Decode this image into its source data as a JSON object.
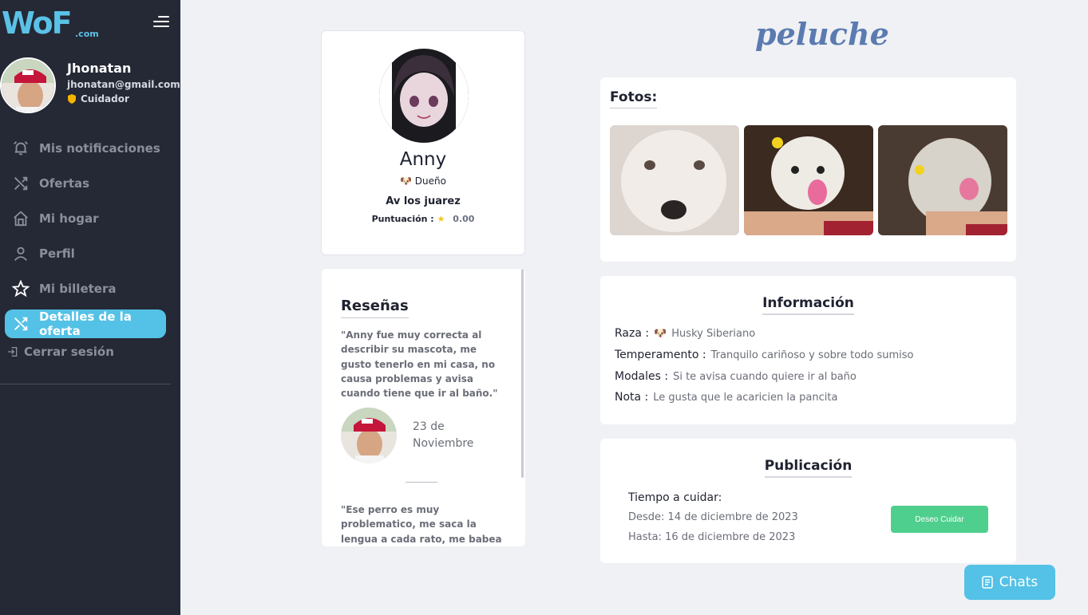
{
  "brand": {
    "logo_text": "WoF",
    "logo_domain": ".com"
  },
  "user": {
    "name": "Jhonatan",
    "email": "jhonatan@gmail.com",
    "role": "Cuidador"
  },
  "nav": {
    "items": [
      {
        "label": "Mis notificaciones",
        "icon": "bell-icon"
      },
      {
        "label": "Ofertas",
        "icon": "shuffle-icon"
      },
      {
        "label": "Mi hogar",
        "icon": "home-icon"
      },
      {
        "label": "Perfil",
        "icon": "user-icon"
      },
      {
        "label": "Mi billetera",
        "icon": "star-icon"
      },
      {
        "label": "Detalles de la oferta",
        "icon": "shuffle-icon",
        "active": true
      }
    ],
    "logout": "Cerrar sesión"
  },
  "owner": {
    "name": "Anny",
    "role": "Dueño",
    "address": "Av los juarez",
    "score_label": "Puntuación :",
    "score_value": "0.00"
  },
  "reviews": {
    "title": "Reseñas",
    "items": [
      {
        "text": "\"Anny fue muy correcta al describir su mascota, me gusto tenerlo en mi casa, no causa problemas y avisa cuando tiene que ir al baño.\"",
        "date": "23 de Noviembre"
      },
      {
        "text": "\"Ese perro es muy problematico, me saca la lengua a cada rato, me babea el mueble, cero"
      }
    ]
  },
  "pet": {
    "name": "peluche",
    "photos_title": "Fotos:",
    "info_title": "Información",
    "info": [
      {
        "label": "Raza :",
        "value": "Husky Siberiano",
        "icon": "dog-icon"
      },
      {
        "label": "Temperamento :",
        "value": "Tranquilo cariñoso y sobre todo sumiso"
      },
      {
        "label": "Modales :",
        "value": "Si te avisa cuando quiere ir al baño"
      },
      {
        "label": "Nota :",
        "value": "Le gusta que le acaricien la pancita"
      }
    ]
  },
  "publication": {
    "title": "Publicación",
    "care_label": "Tiempo a cuidar:",
    "from": "Desde: 14 de diciembre de 2023",
    "to": "Hasta: 16 de diciembre de 2023",
    "button": "Deseo Cuidar"
  },
  "chats": {
    "label": "Chats"
  },
  "colors": {
    "accent": "#54c1e6",
    "sidebar": "#252935",
    "success": "#4fcf8e",
    "pet_name": "#5b7bb0"
  }
}
